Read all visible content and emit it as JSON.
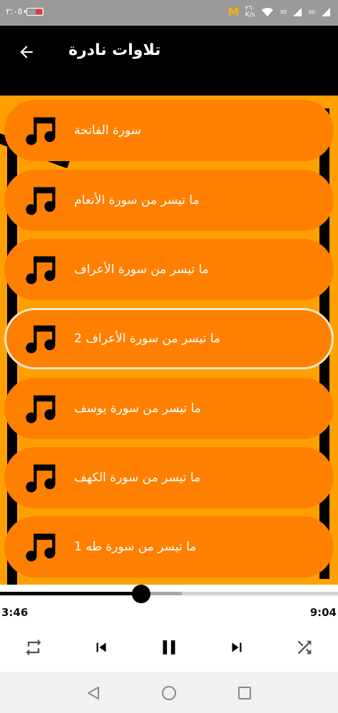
{
  "status_bar": {
    "time": "٢:٠٥",
    "speed_value": "٢٦٠",
    "speed_unit": "K/s",
    "signal_1": "3G",
    "signal_2": "3G"
  },
  "header": {
    "title": "تلاوات نادرة"
  },
  "tracks": [
    {
      "title": "سورة الفاتحة",
      "selected": false
    },
    {
      "title": "ما تيسر من سورة الأنعام",
      "selected": false
    },
    {
      "title": "ما تيسر من سورة الأعراف",
      "selected": false
    },
    {
      "title": "ما تيسر من سورة الأعراف 2",
      "selected": true
    },
    {
      "title": "ما تيسر من سورة يوسف",
      "selected": false
    },
    {
      "title": "ما تيسر من سورة الكهف",
      "selected": false
    },
    {
      "title": "ما تيسر من سورة طه 1",
      "selected": false
    }
  ],
  "player": {
    "current_time": "3:46",
    "total_time": "9:04",
    "progress": 0.417,
    "buffered": 0.537
  },
  "colors": {
    "accent": "#ff8000",
    "background_orange": "#ffa000",
    "header": "#000000"
  },
  "icons": {
    "back": "arrow-left-icon",
    "track": "music-note-icon",
    "repeat": "repeat-icon",
    "previous": "skip-previous-icon",
    "pause": "pause-icon",
    "next": "skip-next-icon",
    "shuffle": "shuffle-icon"
  }
}
